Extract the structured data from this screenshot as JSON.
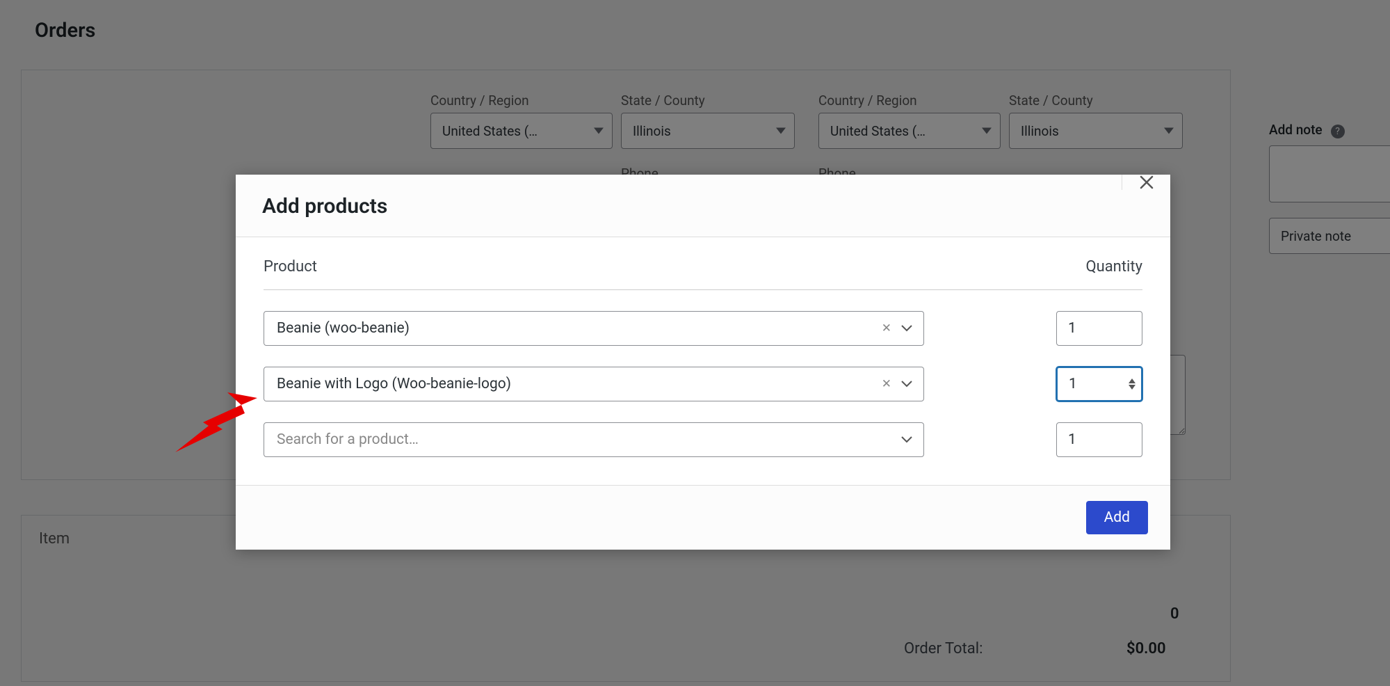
{
  "page_title": "Orders",
  "background": {
    "billing": {
      "country_label": "Country / Region",
      "country_value": "United States (…",
      "state_label": "State / County",
      "state_value": "Illinois"
    },
    "shipping": {
      "country_label": "Country / Region",
      "country_value": "United States (…",
      "state_label": "State / County",
      "state_value": "Illinois"
    },
    "phone_label": "Phone",
    "notes": {
      "add_note_label": "Add note",
      "note_type": "Private note"
    },
    "item_label": "Item",
    "order_total_label": "Order Total:",
    "order_total_value": "$0.00",
    "zero": "0"
  },
  "modal": {
    "title": "Add products",
    "columns": {
      "product": "Product",
      "quantity": "Quantity"
    },
    "rows": [
      {
        "product": "Beanie (woo-beanie)",
        "quantity": "1",
        "has_clear": true,
        "focused": false,
        "placeholder": false
      },
      {
        "product": "Beanie with Logo (Woo-beanie-logo)",
        "quantity": "1",
        "has_clear": true,
        "focused": true,
        "placeholder": false
      },
      {
        "product": "",
        "quantity": "1",
        "has_clear": false,
        "focused": false,
        "placeholder": true
      }
    ],
    "search_placeholder": "Search for a product…",
    "add_button": "Add"
  }
}
